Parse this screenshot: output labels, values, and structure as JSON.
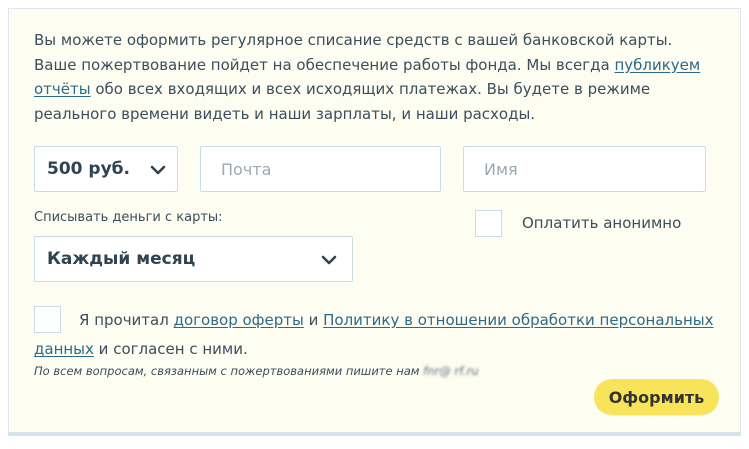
{
  "intro": {
    "text_before_link": "Вы можете оформить регулярное списание средств с вашей банковской карты. Ваше пожертвование пойдет на обеспечение работы фонда. Мы всегда ",
    "link_text": "публикуем отчёты",
    "text_after_link": " обо всех входящих и всех исходящих платежах. Вы будете в режиме реального времени видеть и наши зарплаты, и наши расходы."
  },
  "amount_select": {
    "value": "500 руб.",
    "icon": "chevron-down-icon"
  },
  "email_input": {
    "placeholder": "Почта",
    "value": ""
  },
  "name_input": {
    "placeholder": "Имя",
    "value": ""
  },
  "card_label": "Списывать деньги с карты:",
  "frequency_select": {
    "value": "Каждый месяц",
    "icon": "chevron-down-icon"
  },
  "anonymous": {
    "label": "Оплатить анонимно",
    "checked": false
  },
  "agreement": {
    "checked": false,
    "prefix": "Я прочитал ",
    "offer_link": "договор оферты",
    "middle": " и ",
    "policy_link": "Политику в отношении обработки персональных данных",
    "suffix": " и согласен с ними."
  },
  "note": {
    "text": "По всем вопросам, связанным с пожертвованиями пишите нам ",
    "email_obscured": "fnr@ rf.ru"
  },
  "submit_label": "Оформить",
  "colors": {
    "card_background": "#fefdf2",
    "field_border": "#c9dde8",
    "link": "#2c6a88",
    "button": "#f8e45b",
    "text": "#3a4f5b"
  }
}
